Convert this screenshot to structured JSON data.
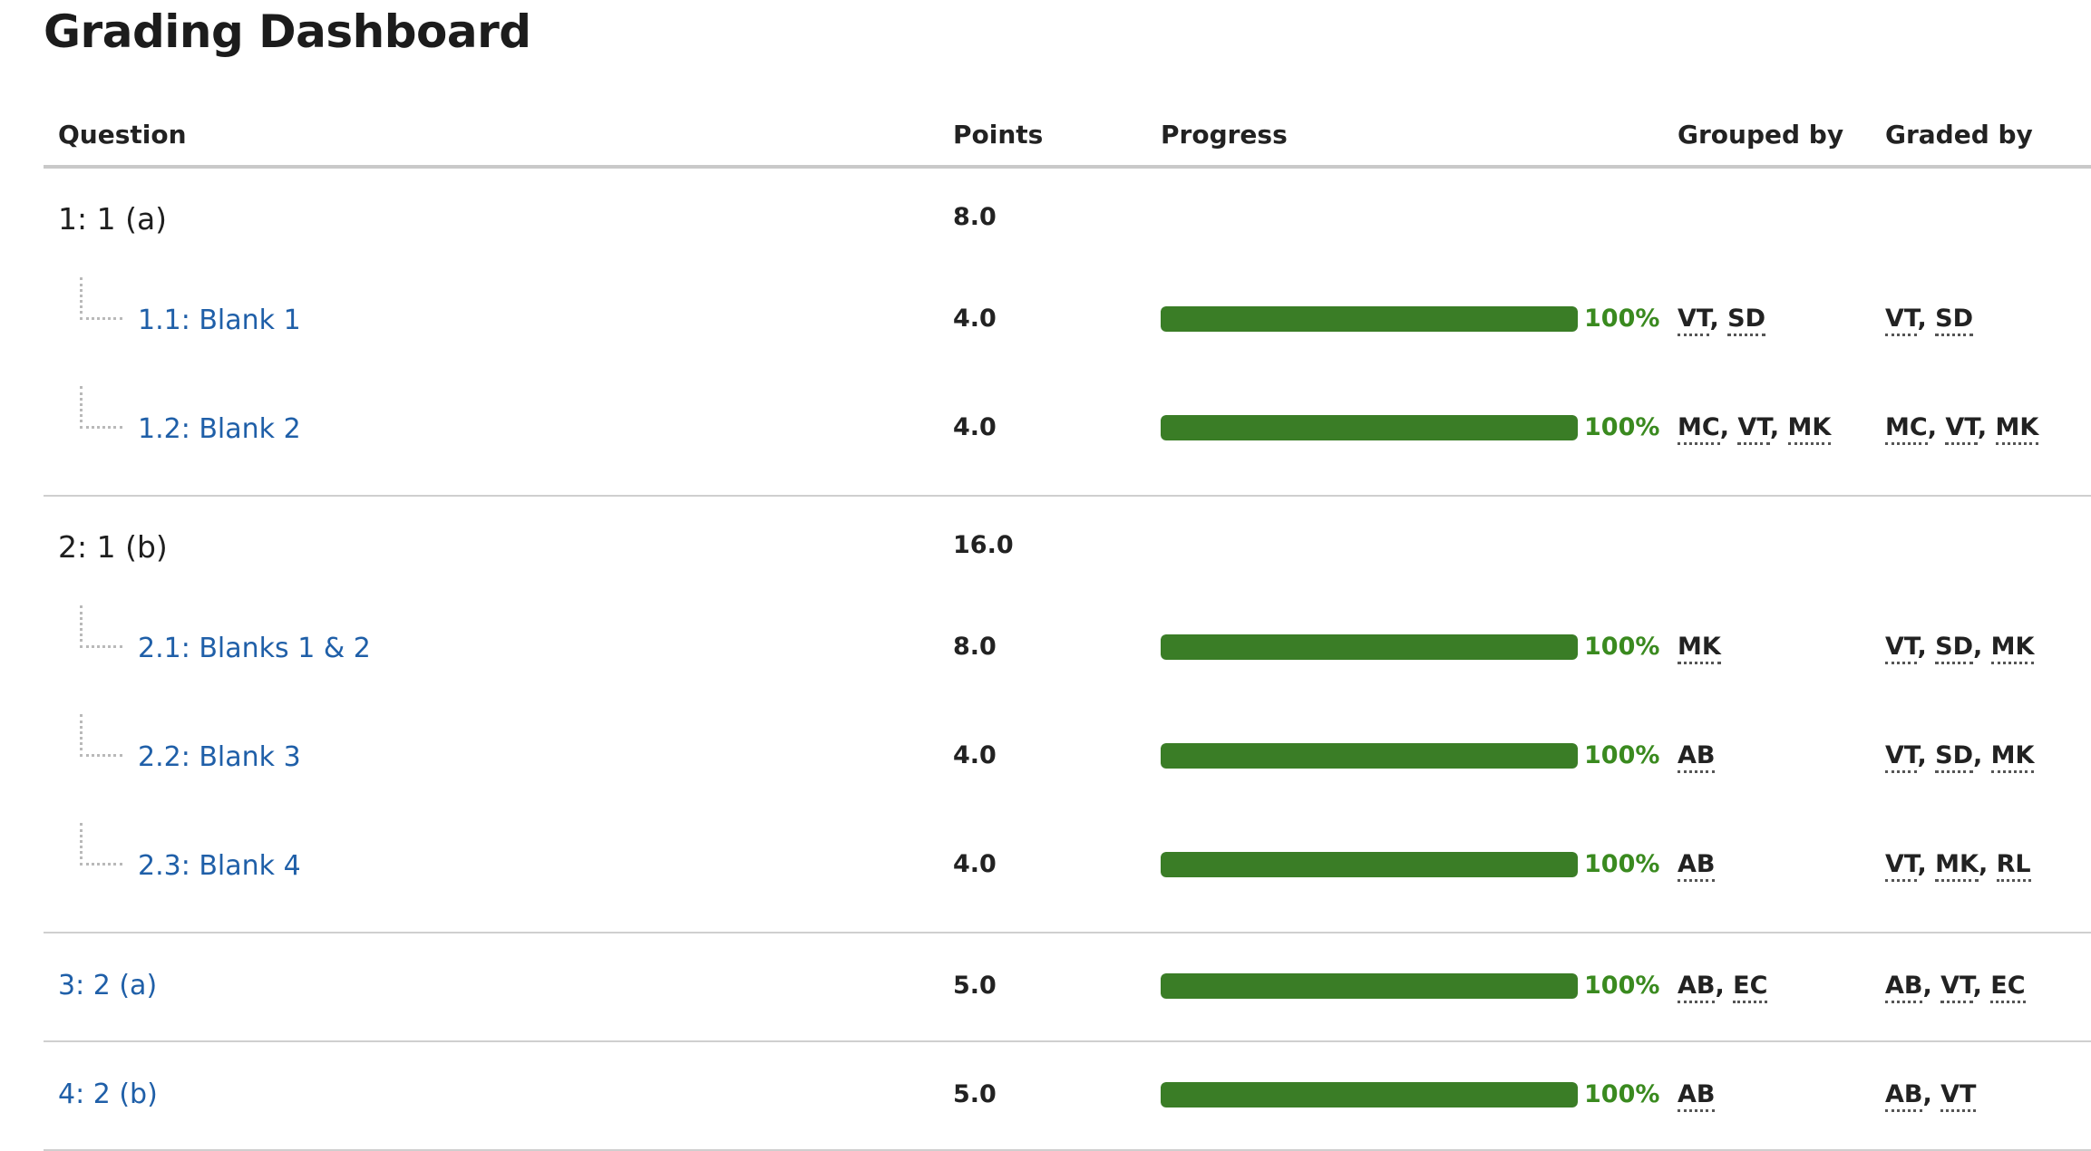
{
  "page": {
    "title": "Grading Dashboard"
  },
  "table": {
    "headers": {
      "question": "Question",
      "points": "Points",
      "progress": "Progress",
      "grouped_by": "Grouped by",
      "graded_by": "Graded by"
    },
    "rows": [
      {
        "label": "1: 1 (a)",
        "points": "8.0"
      },
      {
        "label": "1.1: Blank 1",
        "points": "4.0",
        "progress": 1.0,
        "progress_text": "100%",
        "grouped_by": [
          "VT",
          "SD"
        ],
        "graded_by": [
          "VT",
          "SD"
        ]
      },
      {
        "label": "1.2: Blank 2",
        "points": "4.0",
        "progress": 1.0,
        "progress_text": "100%",
        "grouped_by": [
          "MC",
          "VT",
          "MK"
        ],
        "graded_by": [
          "MC",
          "VT",
          "MK"
        ]
      },
      {
        "label": "2: 1 (b)",
        "points": "16.0"
      },
      {
        "label": "2.1: Blanks 1 & 2",
        "points": "8.0",
        "progress": 1.0,
        "progress_text": "100%",
        "grouped_by": [
          "MK"
        ],
        "graded_by": [
          "VT",
          "SD",
          "MK"
        ]
      },
      {
        "label": "2.2: Blank 3",
        "points": "4.0",
        "progress": 1.0,
        "progress_text": "100%",
        "grouped_by": [
          "AB"
        ],
        "graded_by": [
          "VT",
          "SD",
          "MK"
        ]
      },
      {
        "label": "2.3: Blank 4",
        "points": "4.0",
        "progress": 1.0,
        "progress_text": "100%",
        "grouped_by": [
          "AB"
        ],
        "graded_by": [
          "VT",
          "MK",
          "RL"
        ]
      },
      {
        "label": "3: 2 (a)",
        "points": "5.0",
        "progress": 1.0,
        "progress_text": "100%",
        "grouped_by": [
          "AB",
          "EC"
        ],
        "graded_by": [
          "AB",
          "VT",
          "EC"
        ]
      },
      {
        "label": "4: 2 (b)",
        "points": "5.0",
        "progress": 1.0,
        "progress_text": "100%",
        "grouped_by": [
          "AB"
        ],
        "graded_by": [
          "AB",
          "VT"
        ]
      }
    ]
  },
  "colors": {
    "progress_fill": "#3a7d26",
    "progress_text": "#3a8a1f",
    "link": "#1f5fa8"
  }
}
